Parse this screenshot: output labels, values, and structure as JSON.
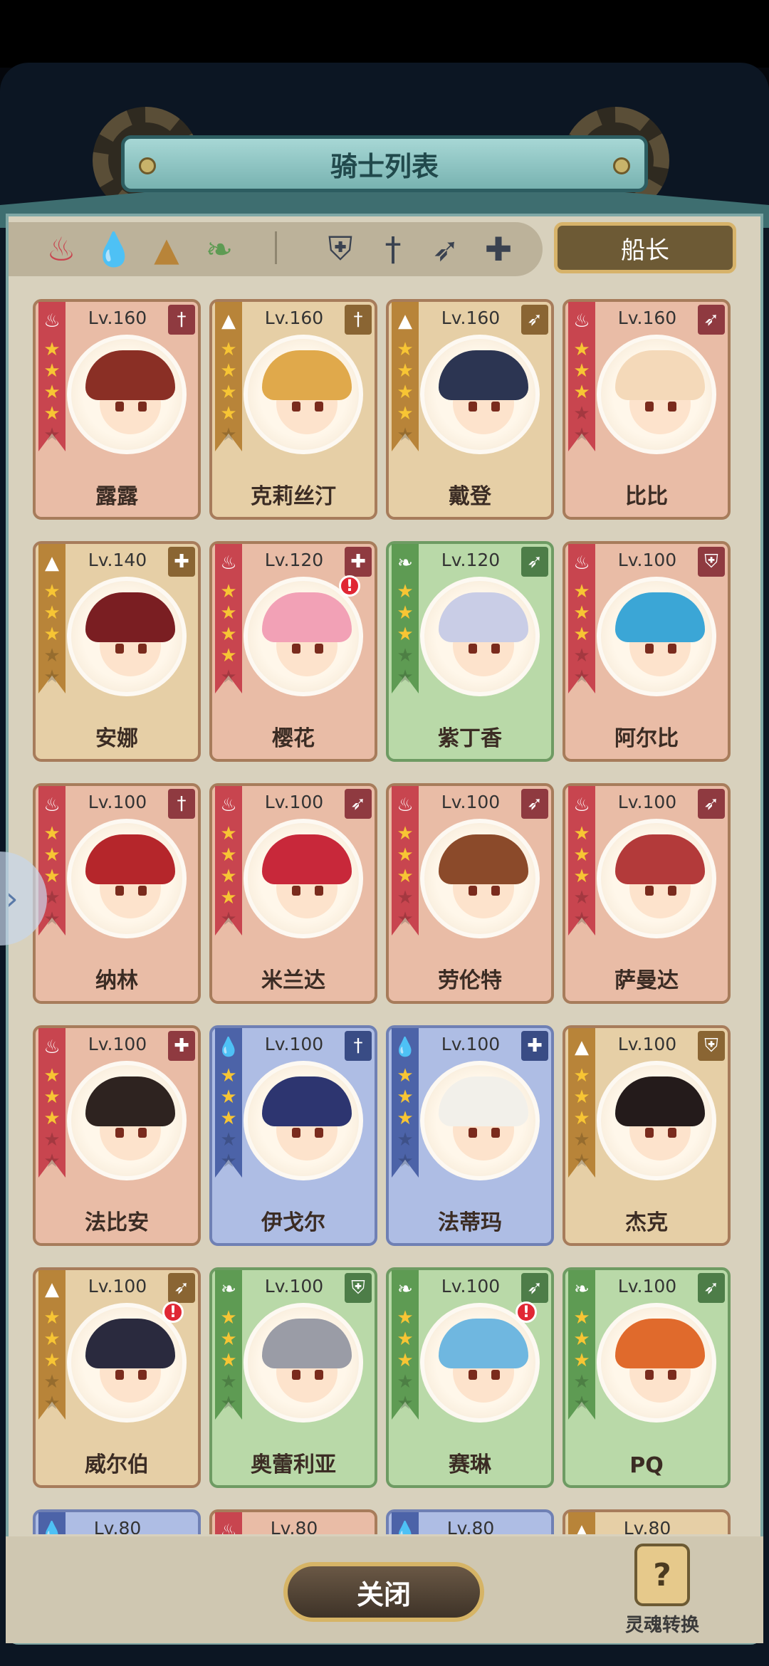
{
  "title": "骑士列表",
  "captain_button": "船长",
  "close_button": "关闭",
  "soul_convert_label": "灵魂转换",
  "soul_icon_glyph": "?",
  "side_tab_glyph": "›",
  "filters": {
    "elements": [
      {
        "name": "fire-element-icon",
        "glyph": "♨"
      },
      {
        "name": "water-element-icon",
        "glyph": "💧"
      },
      {
        "name": "earth-element-icon",
        "glyph": "▲"
      },
      {
        "name": "nature-element-icon",
        "glyph": "❧"
      }
    ],
    "classes": [
      {
        "name": "shield-class-icon",
        "glyph": "⛨"
      },
      {
        "name": "sword-class-icon",
        "glyph": "†"
      },
      {
        "name": "bow-class-icon",
        "glyph": "➶"
      },
      {
        "name": "healer-class-icon",
        "glyph": "✚"
      }
    ]
  },
  "knights": [
    {
      "name": "露露",
      "level": "Lv.160",
      "element": "fire",
      "class_glyph": "†",
      "stars": 4,
      "alert": false,
      "hair": "#8a2f25"
    },
    {
      "name": "克莉丝汀",
      "level": "Lv.160",
      "element": "earth",
      "class_glyph": "†",
      "stars": 4,
      "alert": false,
      "hair": "#e0a94b"
    },
    {
      "name": "戴登",
      "level": "Lv.160",
      "element": "earth",
      "class_glyph": "➶",
      "stars": 4,
      "alert": false,
      "hair": "#2c3552"
    },
    {
      "name": "比比",
      "level": "Lv.160",
      "element": "fire",
      "class_glyph": "➶",
      "stars": 3,
      "alert": false,
      "hair": "#f4d9b9"
    },
    {
      "name": "安娜",
      "level": "Lv.140",
      "element": "earth",
      "class_glyph": "✚",
      "stars": 3,
      "alert": false,
      "hair": "#7a1e22"
    },
    {
      "name": "樱花",
      "level": "Lv.120",
      "element": "fire",
      "class_glyph": "✚",
      "stars": 4,
      "alert": true,
      "hair": "#f2a1b6"
    },
    {
      "name": "紫丁香",
      "level": "Lv.120",
      "element": "nature",
      "class_glyph": "➶",
      "stars": 3,
      "alert": false,
      "hair": "#c9cde6"
    },
    {
      "name": "阿尔比",
      "level": "Lv.100",
      "element": "fire",
      "class_glyph": "⛨",
      "stars": 3,
      "alert": false,
      "hair": "#3ba6d6"
    },
    {
      "name": "纳林",
      "level": "Lv.100",
      "element": "fire",
      "class_glyph": "†",
      "stars": 3,
      "alert": false,
      "hair": "#b5262b"
    },
    {
      "name": "米兰达",
      "level": "Lv.100",
      "element": "fire",
      "class_glyph": "➶",
      "stars": 4,
      "alert": false,
      "hair": "#c8283a"
    },
    {
      "name": "劳伦特",
      "level": "Lv.100",
      "element": "fire",
      "class_glyph": "➶",
      "stars": 3,
      "alert": false,
      "hair": "#8b4a2a"
    },
    {
      "name": "萨曼达",
      "level": "Lv.100",
      "element": "fire",
      "class_glyph": "➶",
      "stars": 3,
      "alert": false,
      "hair": "#b33a3a"
    },
    {
      "name": "法比安",
      "level": "Lv.100",
      "element": "fire",
      "class_glyph": "✚",
      "stars": 3,
      "alert": false,
      "hair": "#2e2320"
    },
    {
      "name": "伊戈尔",
      "level": "Lv.100",
      "element": "water",
      "class_glyph": "†",
      "stars": 3,
      "alert": false,
      "hair": "#2d3570"
    },
    {
      "name": "法蒂玛",
      "level": "Lv.100",
      "element": "water",
      "class_glyph": "✚",
      "stars": 3,
      "alert": false,
      "hair": "#f2f0ea"
    },
    {
      "name": "杰克",
      "level": "Lv.100",
      "element": "earth",
      "class_glyph": "⛨",
      "stars": 3,
      "alert": false,
      "hair": "#241b1b"
    },
    {
      "name": "威尔伯",
      "level": "Lv.100",
      "element": "earth",
      "class_glyph": "➶",
      "stars": 3,
      "alert": true,
      "hair": "#2a2a3e"
    },
    {
      "name": "奥蕾利亚",
      "level": "Lv.100",
      "element": "nature",
      "class_glyph": "⛨",
      "stars": 3,
      "alert": false,
      "hair": "#9a9ca6"
    },
    {
      "name": "赛琳",
      "level": "Lv.100",
      "element": "nature",
      "class_glyph": "➶",
      "stars": 3,
      "alert": true,
      "hair": "#6fb7e0"
    },
    {
      "name": "PQ",
      "level": "Lv.100",
      "element": "nature",
      "class_glyph": "➶",
      "stars": 3,
      "alert": false,
      "hair": "#e06a2c"
    },
    {
      "name": "",
      "level": "Lv.80",
      "element": "water",
      "class_glyph": "",
      "stars": 3,
      "alert": false,
      "hair": "#7c8bbf"
    },
    {
      "name": "",
      "level": "Lv.80",
      "element": "fire",
      "class_glyph": "",
      "stars": 3,
      "alert": false,
      "hair": "#c8454f"
    },
    {
      "name": "",
      "level": "Lv.80",
      "element": "water",
      "class_glyph": "",
      "stars": 3,
      "alert": false,
      "hair": "#7c8bbf"
    },
    {
      "name": "",
      "level": "Lv.80",
      "element": "earth",
      "class_glyph": "",
      "stars": 3,
      "alert": false,
      "hair": "#b88439"
    }
  ],
  "element_glyphs": {
    "fire": "♨",
    "water": "💧",
    "earth": "▲",
    "nature": "❧"
  }
}
